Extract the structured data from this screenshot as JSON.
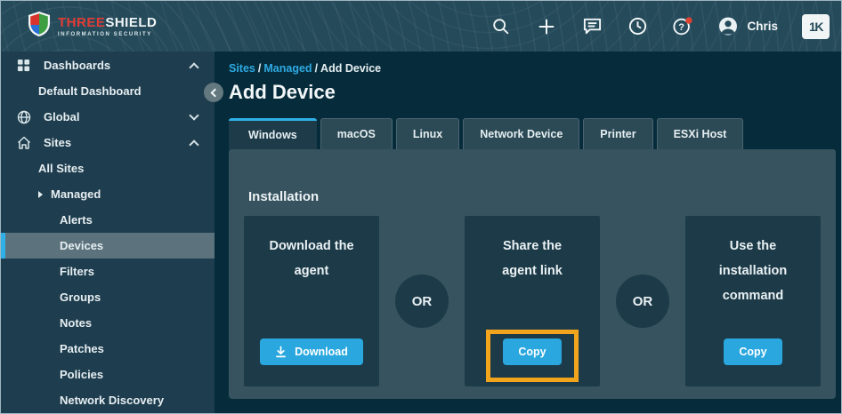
{
  "topbar": {
    "logo": {
      "brand_primary": "THREE",
      "brand_secondary": "SHIELD",
      "tagline": "INFORMATION SECURITY"
    },
    "icons": [
      "search-icon",
      "add-icon",
      "messages-icon",
      "history-clock-icon",
      "help-icon",
      "account-icon"
    ],
    "user_name": "Chris",
    "app_badge": "1K"
  },
  "sidebar": {
    "items": [
      {
        "label": "Dashboards"
      },
      {
        "label": "Default Dashboard"
      },
      {
        "label": "Global"
      },
      {
        "label": "Sites"
      },
      {
        "label": "All Sites"
      },
      {
        "label": "Managed"
      },
      {
        "label": "Alerts"
      },
      {
        "label": "Devices"
      },
      {
        "label": "Filters"
      },
      {
        "label": "Groups"
      },
      {
        "label": "Notes"
      },
      {
        "label": "Patches"
      },
      {
        "label": "Policies"
      },
      {
        "label": "Network Discovery"
      }
    ],
    "selected": "Devices"
  },
  "breadcrumb": {
    "link1": "Sites",
    "link2": "Managed",
    "separator": "/",
    "current": "Add Device"
  },
  "page": {
    "title": "Add Device"
  },
  "tabs": {
    "active": "Windows",
    "items": [
      "Windows",
      "macOS",
      "Linux",
      "Network Device",
      "Printer",
      "ESXi Host"
    ]
  },
  "installation": {
    "heading": "Installation",
    "or_label": "OR",
    "cards": [
      {
        "title_line1": "Download the",
        "title_line2": "agent",
        "button": "Download"
      },
      {
        "title_line1": "Share the",
        "title_line2": "agent link",
        "button": "Copy"
      },
      {
        "title_line1": "Use the",
        "title_line2": "installation",
        "title_line3": "command",
        "button": "Copy"
      }
    ]
  },
  "colors": {
    "accent_blue": "#29A7DE",
    "link_blue": "#2FA9E2",
    "active_tab_indicator": "#2FB1E8",
    "highlight_orange": "#F2A41D",
    "notification_red": "#E04231",
    "topbar_bg": "#254B5B",
    "sidebar_bg": "#1E3D4E",
    "content_bg": "#062C3B",
    "panel_bg": "#36535F",
    "card_bg": "#1C3A48"
  }
}
